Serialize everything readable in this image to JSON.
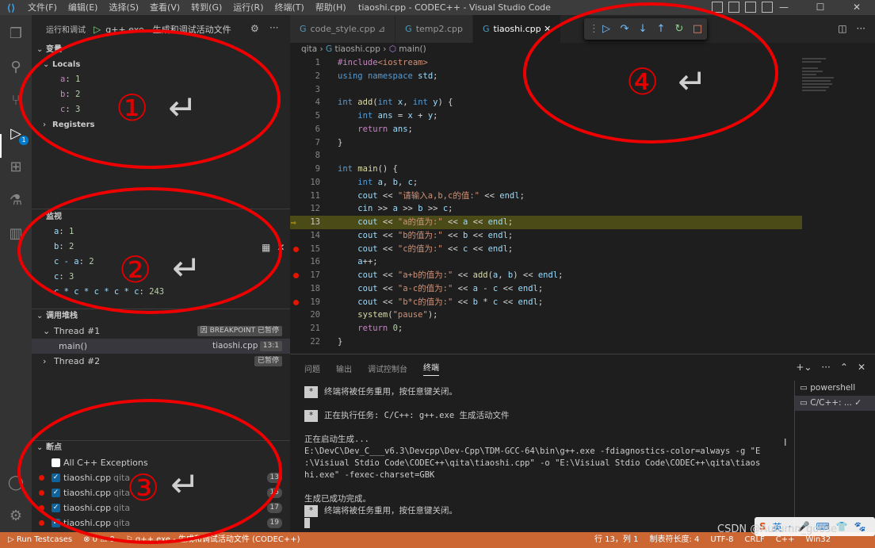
{
  "window": {
    "title": "tiaoshi.cpp - CODEC++ - Visual Studio Code",
    "menu": [
      "文件(F)",
      "编辑(E)",
      "选择(S)",
      "查看(V)",
      "转到(G)",
      "运行(R)",
      "终端(T)",
      "帮助(H)"
    ],
    "controls": [
      "—",
      "☐",
      "✕"
    ]
  },
  "activity": {
    "debug_badge": "1"
  },
  "sidebar": {
    "header": "运行和调试",
    "config_label": "g++.exe - 生成和调试活动文件",
    "variables_title": "变量",
    "locals_label": "Locals",
    "locals": [
      {
        "name": "a",
        "value": "1"
      },
      {
        "name": "b",
        "value": "2"
      },
      {
        "name": "c",
        "value": "3"
      }
    ],
    "registers_label": "Registers",
    "watch_title": "监视",
    "watch": [
      {
        "expr": "a",
        "value": "1"
      },
      {
        "expr": "b",
        "value": "2"
      },
      {
        "expr": "c - a",
        "value": "2"
      },
      {
        "expr": "c",
        "value": "3"
      },
      {
        "expr": "c * c * c * c * c",
        "value": "243"
      }
    ],
    "callstack_title": "调用堆栈",
    "threads": [
      {
        "name": "Thread #1",
        "state": "因 BREAKPOINT 已暂停"
      },
      {
        "name": "Thread #2",
        "state": "已暂停"
      }
    ],
    "frame": {
      "name": "main()",
      "file": "tiaoshi.cpp",
      "pos": "13:1"
    },
    "breakpoints_title": "断点",
    "breakpoints": [
      {
        "label": "All C++ Exceptions",
        "folder": "",
        "line": "",
        "checked": false,
        "dot": false
      },
      {
        "label": "tiaoshi.cpp",
        "folder": "qita",
        "line": "13",
        "checked": true,
        "dot": true
      },
      {
        "label": "tiaoshi.cpp",
        "folder": "qita",
        "line": "15",
        "checked": true,
        "dot": true
      },
      {
        "label": "tiaoshi.cpp",
        "folder": "qita",
        "line": "17",
        "checked": true,
        "dot": true
      },
      {
        "label": "tiaoshi.cpp",
        "folder": "qita",
        "line": "19",
        "checked": true,
        "dot": true
      }
    ]
  },
  "editor": {
    "tabs": [
      {
        "label": "code_style.cpp",
        "suffix": "⊿",
        "active": false
      },
      {
        "label": "temp2.cpp",
        "suffix": "",
        "active": false
      },
      {
        "label": "tiaoshi.cpp",
        "suffix": "✕",
        "active": true
      }
    ],
    "breadcrumb": [
      "qita",
      "tiaoshi.cpp",
      "main()"
    ],
    "current_line": 13,
    "breakpoint_lines": [
      15,
      17,
      19
    ],
    "lines": [
      {
        "n": "1",
        "tokens": [
          [
            "pp",
            "#include"
          ],
          [
            "str",
            "<iostream>"
          ]
        ]
      },
      {
        "n": "2",
        "tokens": [
          [
            "kw",
            "using"
          ],
          [
            "",
            " "
          ],
          [
            "kw",
            "namespace"
          ],
          [
            "",
            " "
          ],
          [
            "id",
            "std"
          ],
          [
            "",
            ";"
          ]
        ]
      },
      {
        "n": "3",
        "tokens": []
      },
      {
        "n": "4",
        "tokens": [
          [
            "kw",
            "int"
          ],
          [
            "",
            " "
          ],
          [
            "fn",
            "add"
          ],
          [
            "",
            "("
          ],
          [
            "kw",
            "int"
          ],
          [
            "",
            " "
          ],
          [
            "id",
            "x"
          ],
          [
            "",
            ", "
          ],
          [
            "kw",
            "int"
          ],
          [
            "",
            " "
          ],
          [
            "id",
            "y"
          ],
          [
            "",
            ") {"
          ]
        ]
      },
      {
        "n": "5",
        "tokens": [
          [
            "",
            "    "
          ],
          [
            "kw",
            "int"
          ],
          [
            "",
            " "
          ],
          [
            "id",
            "ans"
          ],
          [
            "",
            " = "
          ],
          [
            "id",
            "x"
          ],
          [
            "",
            " + "
          ],
          [
            "id",
            "y"
          ],
          [
            "",
            ";"
          ]
        ]
      },
      {
        "n": "6",
        "tokens": [
          [
            "",
            "    "
          ],
          [
            "pp",
            "return"
          ],
          [
            "",
            " "
          ],
          [
            "id",
            "ans"
          ],
          [
            "",
            ";"
          ]
        ]
      },
      {
        "n": "7",
        "tokens": [
          [
            "",
            "}"
          ]
        ]
      },
      {
        "n": "8",
        "tokens": []
      },
      {
        "n": "9",
        "tokens": [
          [
            "kw",
            "int"
          ],
          [
            "",
            " "
          ],
          [
            "fn",
            "main"
          ],
          [
            "",
            "() {"
          ]
        ]
      },
      {
        "n": "10",
        "tokens": [
          [
            "",
            "    "
          ],
          [
            "kw",
            "int"
          ],
          [
            "",
            " "
          ],
          [
            "id",
            "a"
          ],
          [
            "",
            ", "
          ],
          [
            "id",
            "b"
          ],
          [
            "",
            ", "
          ],
          [
            "id",
            "c"
          ],
          [
            "",
            ";"
          ]
        ]
      },
      {
        "n": "11",
        "tokens": [
          [
            "",
            "    "
          ],
          [
            "id",
            "cout"
          ],
          [
            "",
            " << "
          ],
          [
            "str",
            "\"请输入a,b,c的值:\""
          ],
          [
            "",
            " << "
          ],
          [
            "id",
            "endl"
          ],
          [
            "",
            ";"
          ]
        ]
      },
      {
        "n": "12",
        "tokens": [
          [
            "",
            "    "
          ],
          [
            "id",
            "cin"
          ],
          [
            "",
            " >> "
          ],
          [
            "id",
            "a"
          ],
          [
            "",
            " >> "
          ],
          [
            "id",
            "b"
          ],
          [
            "",
            " >> "
          ],
          [
            "id",
            "c"
          ],
          [
            "",
            ";"
          ]
        ]
      },
      {
        "n": "13",
        "tokens": [
          [
            "",
            "    "
          ],
          [
            "id",
            "cout"
          ],
          [
            "",
            " << "
          ],
          [
            "str",
            "\"a的值为:\""
          ],
          [
            "",
            " << "
          ],
          [
            "id",
            "a"
          ],
          [
            "",
            " << "
          ],
          [
            "id",
            "endl"
          ],
          [
            "",
            ";"
          ]
        ]
      },
      {
        "n": "14",
        "tokens": [
          [
            "",
            "    "
          ],
          [
            "id",
            "cout"
          ],
          [
            "",
            " << "
          ],
          [
            "str",
            "\"b的值为:\""
          ],
          [
            "",
            " << "
          ],
          [
            "id",
            "b"
          ],
          [
            "",
            " << "
          ],
          [
            "id",
            "endl"
          ],
          [
            "",
            ";"
          ]
        ]
      },
      {
        "n": "15",
        "tokens": [
          [
            "",
            "    "
          ],
          [
            "id",
            "cout"
          ],
          [
            "",
            " << "
          ],
          [
            "str",
            "\"c的值为:\""
          ],
          [
            "",
            " << "
          ],
          [
            "id",
            "c"
          ],
          [
            "",
            " << "
          ],
          [
            "id",
            "endl"
          ],
          [
            "",
            ";"
          ]
        ]
      },
      {
        "n": "16",
        "tokens": [
          [
            "",
            "    "
          ],
          [
            "id",
            "a"
          ],
          [
            "",
            "++;"
          ]
        ]
      },
      {
        "n": "17",
        "tokens": [
          [
            "",
            "    "
          ],
          [
            "id",
            "cout"
          ],
          [
            "",
            " << "
          ],
          [
            "str",
            "\"a+b的值为:\""
          ],
          [
            "",
            " << "
          ],
          [
            "fn",
            "add"
          ],
          [
            "",
            "("
          ],
          [
            "id",
            "a"
          ],
          [
            "",
            ", "
          ],
          [
            "id",
            "b"
          ],
          [
            "",
            ") << "
          ],
          [
            "id",
            "endl"
          ],
          [
            "",
            ";"
          ]
        ]
      },
      {
        "n": "18",
        "tokens": [
          [
            "",
            "    "
          ],
          [
            "id",
            "cout"
          ],
          [
            "",
            " << "
          ],
          [
            "str",
            "\"a-c的值为:\""
          ],
          [
            "",
            " << "
          ],
          [
            "id",
            "a"
          ],
          [
            "",
            " - "
          ],
          [
            "id",
            "c"
          ],
          [
            "",
            " << "
          ],
          [
            "id",
            "endl"
          ],
          [
            "",
            ";"
          ]
        ]
      },
      {
        "n": "19",
        "tokens": [
          [
            "",
            "    "
          ],
          [
            "id",
            "cout"
          ],
          [
            "",
            " << "
          ],
          [
            "str",
            "\"b*c的值为:\""
          ],
          [
            "",
            " << "
          ],
          [
            "id",
            "b"
          ],
          [
            "",
            " * "
          ],
          [
            "id",
            "c"
          ],
          [
            "",
            " << "
          ],
          [
            "id",
            "endl"
          ],
          [
            "",
            ";"
          ]
        ]
      },
      {
        "n": "20",
        "tokens": [
          [
            "",
            "    "
          ],
          [
            "fn",
            "system"
          ],
          [
            "",
            "("
          ],
          [
            "str",
            "\"pause\""
          ],
          [
            "",
            ");"
          ]
        ]
      },
      {
        "n": "21",
        "tokens": [
          [
            "",
            "    "
          ],
          [
            "pp",
            "return"
          ],
          [
            "",
            " "
          ],
          [
            "num",
            "0"
          ],
          [
            "",
            ";"
          ]
        ]
      },
      {
        "n": "22",
        "tokens": [
          [
            "",
            "}"
          ]
        ]
      }
    ]
  },
  "panel": {
    "tabs": [
      "问题",
      "输出",
      "调试控制台",
      "终端"
    ],
    "active_tab": "终端",
    "terminal_lines": [
      {
        "star": true,
        "text": "终端将被任务重用，按任意键关闭。"
      },
      {
        "star": false,
        "text": ""
      },
      {
        "star": true,
        "text": "正在执行任务: C/C++: g++.exe 生成活动文件"
      },
      {
        "star": false,
        "text": ""
      },
      {
        "star": false,
        "text": "正在启动生成..."
      },
      {
        "star": false,
        "text": "E:\\DevC\\Dev_C___v6.3\\Devcpp\\Dev-Cpp\\TDM-GCC-64\\bin\\g++.exe -fdiagnostics-color=always -g \"E"
      },
      {
        "star": false,
        "text": ":\\Visiual Stdio Code\\CODEC++\\qita\\tiaoshi.cpp\" -o \"E:\\Visiual Stdio Code\\CODEC++\\qita\\tiaos"
      },
      {
        "star": false,
        "text": "hi.exe\" -fexec-charset=GBK"
      },
      {
        "star": false,
        "text": ""
      },
      {
        "star": false,
        "text": "生成已成功完成。"
      },
      {
        "star": true,
        "text": "终端将被任务重用，按任意键关闭。"
      }
    ],
    "terminals": [
      {
        "label": "powershell",
        "selected": false
      },
      {
        "label": "C/C++: ...",
        "selected": true
      }
    ]
  },
  "statusbar": {
    "left": [
      "Run Testcases",
      "⊗ 0 ⚠ 0",
      "g++.exe - 生成和调试活动文件 (CODEC++)"
    ],
    "right": [
      "行 13，列 1",
      "制表符长度: 4",
      "UTF-8",
      "CRLF",
      "C++",
      "Win32"
    ],
    "color": "#cc6633"
  },
  "watermark": "CSDN @Autumn_goose",
  "ime": [
    "S",
    "英",
    "·",
    "🎤",
    "⌨",
    "👕",
    "🐾"
  ],
  "annotations": [
    "①",
    "②",
    "③",
    "④"
  ],
  "annotation_arrow": "↵"
}
